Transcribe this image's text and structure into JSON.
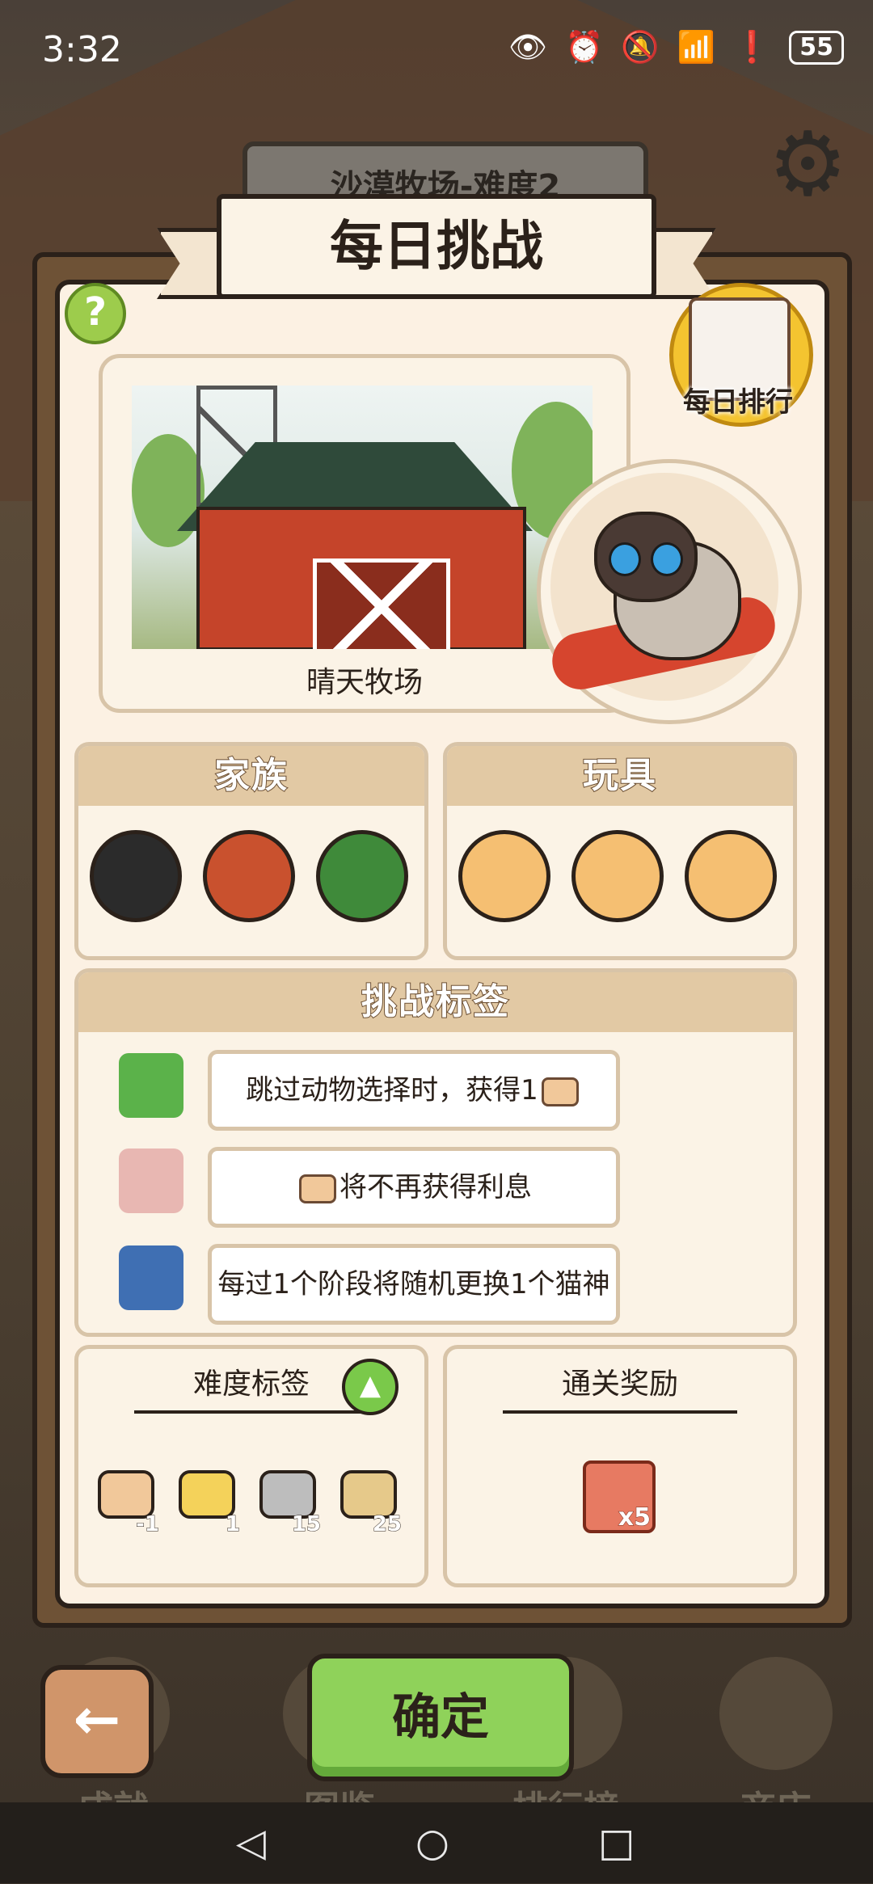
{
  "status_bar": {
    "time": "3:32",
    "battery": "55"
  },
  "background": {
    "sign_text": "沙漠牧场-难度2"
  },
  "dialog": {
    "title": "每日挑战",
    "help_label": "?",
    "daily_rank_label": "每日排行",
    "scene": {
      "name": "晴天牧场"
    },
    "family": {
      "title": "家族",
      "items": [
        "cat-icon",
        "bird-icon",
        "frog-icon"
      ]
    },
    "toys": {
      "title": "玩具",
      "items": [
        "fish-toy-icon",
        "handheld-console-icon",
        "pet-collar-icon"
      ]
    },
    "challenge_tags": {
      "title": "挑战标签",
      "items": [
        {
          "icon": "recycle-bin-icon",
          "text": "跳过动物选择时，获得1"
        },
        {
          "icon": "pig-bank-icon",
          "text": "将不再获得利息"
        },
        {
          "icon": "cat-dice-icon",
          "text": "每过1个阶段将随机更换1个猫神"
        }
      ]
    },
    "difficulty_tags": {
      "title": "难度标签",
      "items": [
        {
          "icon": "can-icon",
          "value": "-1"
        },
        {
          "icon": "barrier-icon",
          "value": "1"
        },
        {
          "icon": "ghost-icon",
          "value": "15"
        },
        {
          "icon": "can-barrier-icon",
          "value": "25"
        }
      ]
    },
    "rewards": {
      "title": "通关奖励",
      "item": {
        "icon": "ticket-icon",
        "count": "x5"
      }
    }
  },
  "bottom_nav": {
    "back_label": "←",
    "confirm_label": "确定",
    "items": [
      "成就",
      "图鉴",
      "排行榜",
      "商店"
    ]
  },
  "colors": {
    "accent_green": "#8fd25a",
    "panel_bg": "#fbf3e6",
    "header_tan": "#e2c9a4",
    "frame_brown": "#6e5236"
  }
}
